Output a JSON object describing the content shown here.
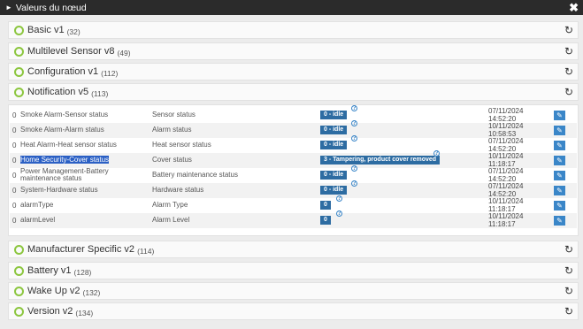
{
  "window": {
    "title": "Valeurs du nœud",
    "close_glyph": "✖"
  },
  "sections_top": [
    {
      "title": "Basic v1",
      "count": "(32)"
    },
    {
      "title": "Multilevel Sensor v8",
      "count": "(49)"
    },
    {
      "title": "Configuration v1",
      "count": "(112)"
    },
    {
      "title": "Notification v5",
      "count": "(113)"
    }
  ],
  "notification_rows": [
    {
      "idx": "0",
      "name": "Smoke Alarm-Sensor status",
      "label": "Sensor status",
      "value": "0 - idle",
      "date": "07/11/2024",
      "time": "14:52:20"
    },
    {
      "idx": "0",
      "name": "Smoke Alarm-Alarm status",
      "label": "Alarm status",
      "value": "0 - idle",
      "date": "10/11/2024",
      "time": "10:58:53"
    },
    {
      "idx": "0",
      "name": "Heat Alarm-Heat sensor status",
      "label": "Heat sensor status",
      "value": "0 - idle",
      "date": "07/11/2024",
      "time": "14:52:20"
    },
    {
      "idx": "0",
      "name": "Home Security-Cover status",
      "label": "Cover status",
      "value": "3 - Tampering, product cover removed",
      "date": "10/11/2024",
      "time": "11:18:17"
    },
    {
      "idx": "0",
      "name": "Power Management-Battery maintenance status",
      "label": "Battery maintenance status",
      "value": "0 - idle",
      "date": "07/11/2024",
      "time": "14:52:20"
    },
    {
      "idx": "0",
      "name": "System-Hardware status",
      "label": "Hardware status",
      "value": "0 - idle",
      "date": "07/11/2024",
      "time": "14:52:20"
    },
    {
      "idx": "0",
      "name": "alarmType",
      "label": "Alarm Type",
      "value": "0",
      "date": "10/11/2024",
      "time": "11:18:17"
    },
    {
      "idx": "0",
      "name": "alarmLevel",
      "label": "Alarm Level",
      "value": "0",
      "date": "10/11/2024",
      "time": "11:18:17"
    }
  ],
  "sections_bottom": [
    {
      "title": "Manufacturer Specific v2",
      "count": "(114)"
    },
    {
      "title": "Battery v1",
      "count": "(128)"
    },
    {
      "title": "Wake Up v2",
      "count": "(132)"
    },
    {
      "title": "Version v2",
      "count": "(134)"
    }
  ],
  "icons": {
    "status": "circle-icon",
    "refresh": "refresh-icon",
    "help": "help-icon",
    "edit": "pencil-icon"
  },
  "colors": {
    "titlebar": "#2b2b2b",
    "status_ring": "#8cc63f",
    "badge": "#2d6ca2",
    "edit_button": "#3a86c8",
    "selection": "#2a5fc4"
  }
}
